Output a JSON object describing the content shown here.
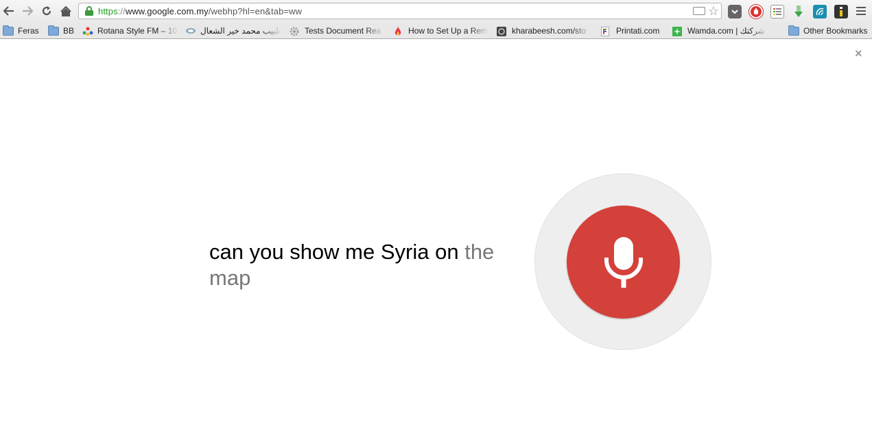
{
  "browser": {
    "url": {
      "scheme": "https",
      "separator": "://",
      "host": "www.google.com.my",
      "path": "/webhp?hl=en&tab=ww"
    },
    "bookmarks": [
      {
        "label": "Feras",
        "icon": "folder-icon"
      },
      {
        "label": "BB",
        "icon": "folder-icon"
      },
      {
        "label": "Rotana Style FM – 10",
        "icon": "rotana-icon"
      },
      {
        "label": "ع الطبيب محمد خير الشعال",
        "icon": "site-icon"
      },
      {
        "label": "Tests Document Rea",
        "icon": "gear-icon"
      },
      {
        "label": "How to Set Up a Rem",
        "icon": "flame-icon"
      },
      {
        "label": "kharabeesh.com/sto",
        "icon": "site-icon"
      },
      {
        "label": "Printati.com",
        "icon": "printati-icon"
      },
      {
        "label": "Wamda.com | شركتك",
        "icon": "wamda-icon"
      },
      {
        "label": "Other Bookmarks",
        "icon": "folder-icon"
      }
    ]
  },
  "voice_search": {
    "final_text": "can you show me Syria on",
    "interim_text": "the map",
    "close_label": "×",
    "mic_color": "#d4403a"
  }
}
